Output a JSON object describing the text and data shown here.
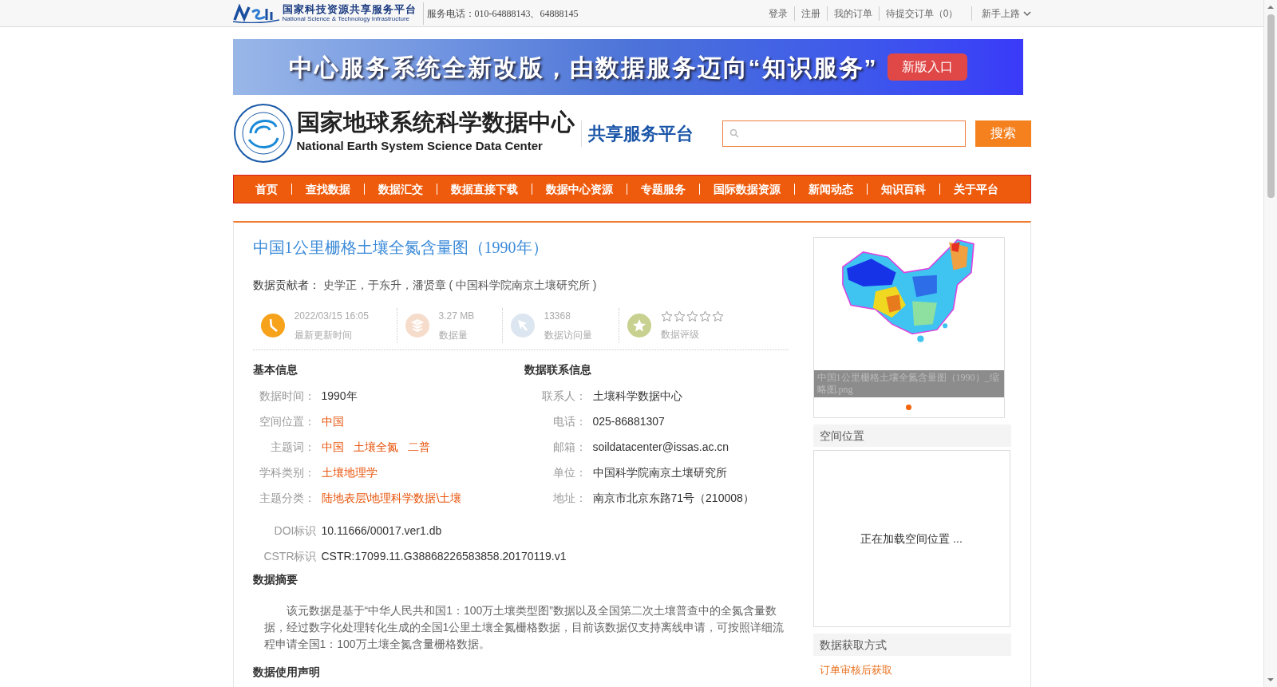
{
  "top_bar": {
    "logo_cn": "国家科技资源共享服务平台",
    "logo_en": "National Science & Technology Infrastructure",
    "hotline": "服务电话：010-64888143、64888145",
    "links": [
      "登录",
      "注册",
      "我的订单",
      "待提交订单（0）"
    ],
    "guide": "新手上路"
  },
  "banner": {
    "text": "中心服务系统全新改版，由数据服务迈向“知识服务”",
    "button": "新版入口"
  },
  "header": {
    "title_cn": "国家地球系统科学数据中心",
    "title_en": "National Earth System Science Data Center",
    "platform": "共享服务平台",
    "search_button": "搜索"
  },
  "nav": [
    "首页",
    "查找数据",
    "数据汇交",
    "数据直接下载",
    "数据中心资源",
    "专题服务",
    "国际数据资源",
    "新闻动态",
    "知识百科",
    "关于平台"
  ],
  "dataset": {
    "title": "中国1公里栅格土壤全氮含量图（1990年）",
    "contributor_label": "数据贡献者：",
    "contributors": "史学正，于东升，潘贤章 ( 中国科学院南京土壤研究所 )",
    "stats": [
      {
        "kind": "time",
        "value": "2022/03/15 16:05",
        "label": "最新更新时间"
      },
      {
        "kind": "size",
        "value": "3.27 MB",
        "label": "数据量"
      },
      {
        "kind": "visits",
        "value": "13368",
        "label": "数据访问量"
      },
      {
        "kind": "rating",
        "stars": 0,
        "label": "数据评级"
      }
    ]
  },
  "basic_info": {
    "heading": "基本信息",
    "rows": [
      {
        "label": "数据时间：",
        "kind": "plain",
        "values": [
          "1990年"
        ]
      },
      {
        "label": "空间位置：",
        "kind": "link",
        "values": [
          "中国"
        ]
      },
      {
        "label": "主题词：",
        "kind": "link",
        "values": [
          "中国",
          "土壤全氮",
          "二普"
        ]
      },
      {
        "label": "学科类别：",
        "kind": "link",
        "values": [
          "土壤地理学"
        ]
      },
      {
        "label": "主题分类：",
        "kind": "link",
        "values": [
          "陆地表层\\地理科学数据\\土壤"
        ]
      }
    ]
  },
  "contact": {
    "heading": "数据联系信息",
    "rows": [
      {
        "label": "联系人：",
        "value": "土壤科学数据中心"
      },
      {
        "label": "电话：",
        "value": "025-86881307"
      },
      {
        "label": "邮箱：",
        "value": "soildatacenter@issas.ac.cn"
      },
      {
        "label": "单位：",
        "value": "中国科学院南京土壤研究所"
      },
      {
        "label": "地址：",
        "value": "南京市北京东路71号（210008）"
      }
    ]
  },
  "identifiers": [
    {
      "label": "DOI标识",
      "value": "10.11666/00017.ver1.db"
    },
    {
      "label": "CSTR标识",
      "value": "CSTR:17099.11.G38868226583858.20170119.v1"
    }
  ],
  "abstract": {
    "heading": "数据摘要",
    "text": "该元数据是基于“中华人民共和国1：100万土壤类型图”数据以及全国第二次土壤普查中的全氮含量数据，经过数字化处理转化生成的全国1公里土壤全氮栅格数据，目前该数据仅支持离线申请，可按照详细流程申请全国1：100万土壤全氮含量栅格数据。"
  },
  "usage_heading": "数据使用声明",
  "sidebar": {
    "thumbnail_caption": "中国1公里栅格土壤全氮含量图（1990）_缩略图.png",
    "slides": [
      {
        "selected": true
      }
    ],
    "location_heading": "空间位置",
    "location_loading": "正在加载空间位置 ...",
    "access_heading": "数据获取方式",
    "access_method": "订单审核后获取"
  }
}
